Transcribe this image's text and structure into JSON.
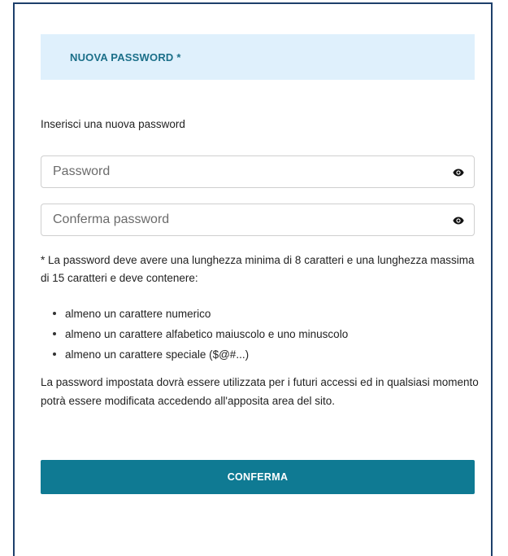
{
  "header": {
    "title": "NUOVA PASSWORD *"
  },
  "form": {
    "instruction": "Inserisci una nuova password",
    "password_placeholder": "Password",
    "confirm_placeholder": "Conferma password",
    "password_value": "",
    "confirm_value": ""
  },
  "icons": {
    "toggle_visibility": "eye-icon"
  },
  "rules": {
    "intro": "* La password deve avere una lunghezza minima di 8 caratteri e una lunghezza massima di 15 caratteri e deve contenere:",
    "items": [
      "almeno un carattere numerico",
      "almeno un carattere alfabetico maiuscolo e uno minuscolo",
      "almeno un carattere speciale ($@#...)"
    ]
  },
  "note": "La password impostata dovrà essere utilizzata per i futuri accessi ed in qualsiasi momento potrà essere modificata accedendo all'apposita area del sito.",
  "actions": {
    "confirm_label": "CONFERMA"
  },
  "colors": {
    "accent": "#0f7a93",
    "header_background": "#dff0fc",
    "header_text": "#1b6f89",
    "border": "#1d3f6b"
  }
}
